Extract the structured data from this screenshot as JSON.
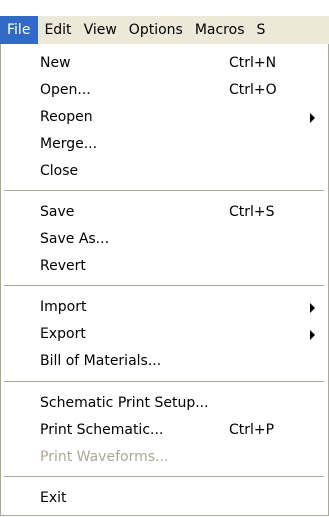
{
  "menubar": {
    "items": [
      "File",
      "Edit",
      "View",
      "Options",
      "Macros",
      "S"
    ]
  },
  "file_menu": {
    "new": {
      "label": "New",
      "shortcut": "Ctrl+N"
    },
    "open": {
      "label": "Open...",
      "shortcut": "Ctrl+O"
    },
    "reopen": {
      "label": "Reopen"
    },
    "merge": {
      "label": "Merge..."
    },
    "close": {
      "label": "Close"
    },
    "save": {
      "label": "Save",
      "shortcut": "Ctrl+S"
    },
    "save_as": {
      "label": "Save As..."
    },
    "revert": {
      "label": "Revert"
    },
    "import": {
      "label": "Import"
    },
    "export": {
      "label": "Export"
    },
    "bom": {
      "label": "Bill of Materials..."
    },
    "print_setup": {
      "label": "Schematic Print Setup..."
    },
    "print_schematic": {
      "label": "Print Schematic...",
      "shortcut": "Ctrl+P"
    },
    "print_waveforms": {
      "label": "Print Waveforms..."
    },
    "exit": {
      "label": "Exit"
    }
  },
  "colors": {
    "highlight": "#316ac5",
    "menubar_bg": "#ece9d8",
    "disabled_text": "#aca899"
  }
}
